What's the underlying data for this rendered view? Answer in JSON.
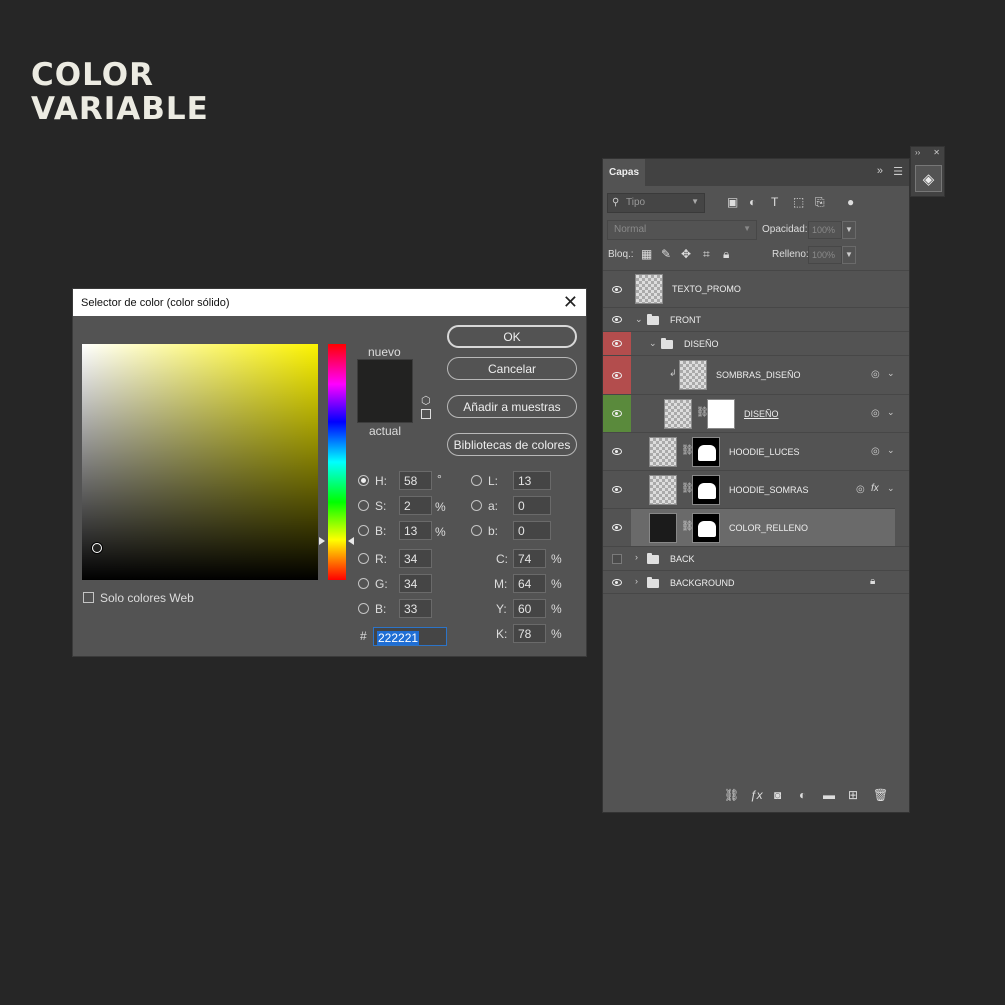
{
  "headline": [
    "COLOR",
    "VARIABLE"
  ],
  "dialog": {
    "title": "Selector de color (color sólido)",
    "close": "✕",
    "label_new": "nuevo",
    "label_current": "actual",
    "new_color": "#222221",
    "buttons": {
      "ok": "OK",
      "cancel": "Cancelar",
      "add_swatches": "Añadir a muestras",
      "libraries": "Bibliotecas de colores"
    },
    "web_only": "Solo colores Web",
    "fields": {
      "H": {
        "label": "H:",
        "value": "58",
        "unit": "°"
      },
      "S": {
        "label": "S:",
        "value": "2",
        "unit": "%"
      },
      "Bv": {
        "label": "B:",
        "value": "13",
        "unit": "%"
      },
      "R": {
        "label": "R:",
        "value": "34"
      },
      "G": {
        "label": "G:",
        "value": "34"
      },
      "Bc": {
        "label": "B:",
        "value": "33"
      },
      "L": {
        "label": "L:",
        "value": "13"
      },
      "a": {
        "label": "a:",
        "value": "0"
      },
      "b": {
        "label": "b:",
        "value": "0"
      },
      "C": {
        "label": "C:",
        "value": "74",
        "unit": "%"
      },
      "M": {
        "label": "M:",
        "value": "64",
        "unit": "%"
      },
      "Y": {
        "label": "Y:",
        "value": "60",
        "unit": "%"
      },
      "K": {
        "label": "K:",
        "value": "78",
        "unit": "%"
      }
    },
    "hex_label": "#",
    "hex_value": "222221"
  },
  "layers_panel": {
    "tab": "Capas",
    "filter_placeholder": "Tipo",
    "blend_mode": "Normal",
    "opacity_label": "Opacidad:",
    "opacity_value": "100%",
    "lock_label": "Bloq.:",
    "fill_label": "Relleno:",
    "fill_value": "100%",
    "layers": [
      {
        "name": "TEXTO_PROMO",
        "kind": "smart"
      },
      {
        "name": "FRONT",
        "kind": "group"
      },
      {
        "name": "DISEÑO",
        "kind": "group"
      },
      {
        "name": "SOMBRAS_DISEÑO",
        "kind": "smart"
      },
      {
        "name": "DISEÑO",
        "kind": "smart-mask"
      },
      {
        "name": "HOODIE_LUCES",
        "kind": "smart-mask"
      },
      {
        "name": "HOODIE_SOMRAS",
        "kind": "smart-mask",
        "fx": "fx"
      },
      {
        "name": "COLOR_RELLENO",
        "kind": "fill-mask"
      },
      {
        "name": "BACK",
        "kind": "group"
      },
      {
        "name": "BACKGROUND",
        "kind": "group"
      }
    ]
  }
}
